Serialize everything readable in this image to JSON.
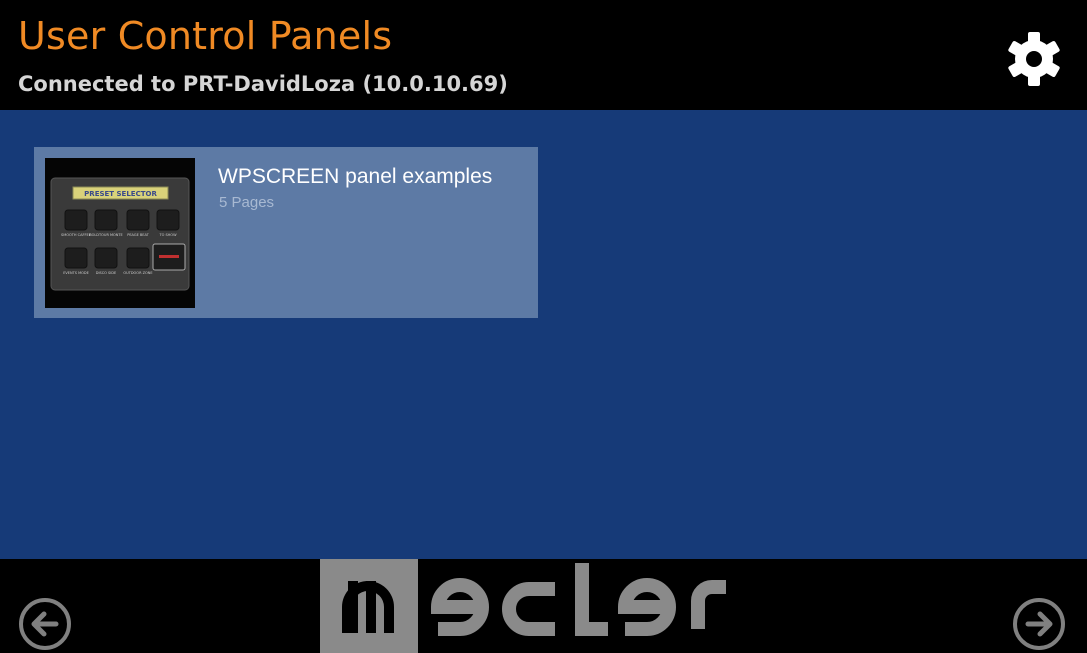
{
  "header": {
    "title": "User Control Panels",
    "subtitle": "Connected to PRT-DavidLoza (10.0.10.69)",
    "settings_icon": "gear-icon"
  },
  "panels": [
    {
      "name": "WPSCREEN panel examples",
      "pages": "5 Pages",
      "thumbnail": {
        "heading": "PRESET SELECTOR",
        "buttons": [
          "SMOOTH CAFFEE",
          "BOLDTOUR MONTE",
          "PEAGE BEAT",
          "TO SHOW",
          "EVENTS MODE",
          "DISCO SIDE",
          "OUTDOOR ZONE"
        ]
      }
    }
  ],
  "footer": {
    "back_icon": "arrow-left-icon",
    "forward_icon": "arrow-right-icon",
    "logo": "ecler",
    "logo_color": "#8a8a8a"
  },
  "colors": {
    "title": "#f08a24",
    "main_bg": "#163a78",
    "card_bg": "#5d7aa5"
  }
}
